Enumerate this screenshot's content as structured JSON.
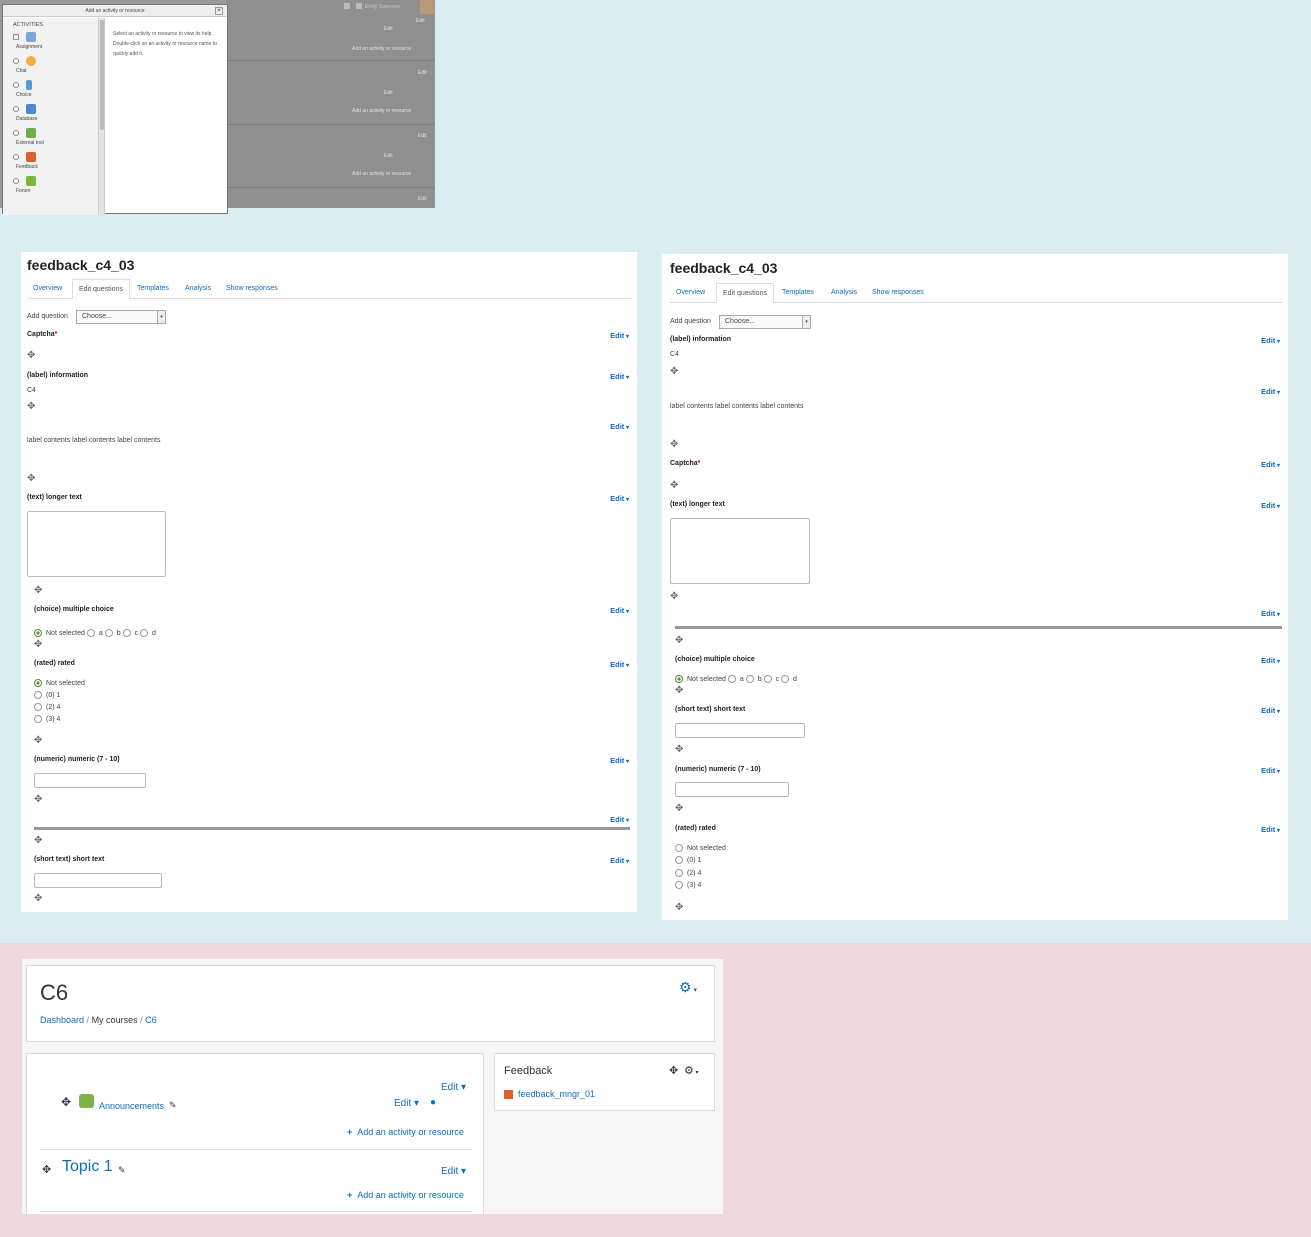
{
  "shot1": {
    "dialog_title": "Add an activity or resource",
    "section_label": "ACTIVITIES",
    "activities": [
      "Assignment",
      "Chat",
      "Choice",
      "Database",
      "External tool",
      "Feedback",
      "Forum"
    ],
    "help_text": "Select an activity or resource to view its help. Double-click on an activity or resource name to quickly add it.",
    "user_name": "Emily Sorensen",
    "edit_label": "Edit",
    "add_label": "Add an activity or resource"
  },
  "left_panel": {
    "title": "feedback_c4_03",
    "tabs": [
      "Overview",
      "Edit questions",
      "Templates",
      "Analysis",
      "Show responses"
    ],
    "add_question_label": "Add question",
    "select_value": "Choose...",
    "edit_label": "Edit",
    "captcha": "Captcha",
    "label_info": "(label) information",
    "label_info_value": "C4",
    "label_contents": "label contents label contents label contents",
    "longer_text": "(text) longer text",
    "multiple_choice": "(choice) multiple choice",
    "choice_options": [
      "Not selected",
      "a",
      "b",
      "c",
      "d"
    ],
    "rated": "(rated) rated",
    "rated_options": [
      "Not selected",
      "(0) 1",
      "(2) 4",
      "(3) 4"
    ],
    "numeric": "(numeric) numeric (7 - 10)",
    "short_text": "(short text) short text"
  },
  "right_panel": {
    "title": "feedback_c4_03",
    "tabs": [
      "Overview",
      "Edit questions",
      "Templates",
      "Analysis",
      "Show responses"
    ],
    "add_question_label": "Add question",
    "select_value": "Choose...",
    "edit_label": "Edit",
    "label_info": "(label) information",
    "label_info_value": "C4",
    "label_contents": "label contents label contents label contents",
    "captcha": "Captcha",
    "longer_text": "(text) longer text",
    "multiple_choice": "(choice) multiple choice",
    "choice_options": [
      "Not selected",
      "a",
      "b",
      "c",
      "d"
    ],
    "short_text": "(short text) short text",
    "numeric": "(numeric) numeric (7 - 10)",
    "rated": "(rated) rated",
    "rated_options": [
      "Not selected",
      "(0) 1",
      "(2) 4",
      "(3) 4"
    ]
  },
  "course": {
    "title": "C6",
    "breadcrumb": [
      "Dashboard",
      "My courses",
      "C6"
    ],
    "edit_label": "Edit",
    "announcements": "Announcements",
    "add_activity": "Add an activity or resource",
    "topic": "Topic 1",
    "block_title": "Feedback",
    "block_item": "feedback_mngr_01"
  }
}
